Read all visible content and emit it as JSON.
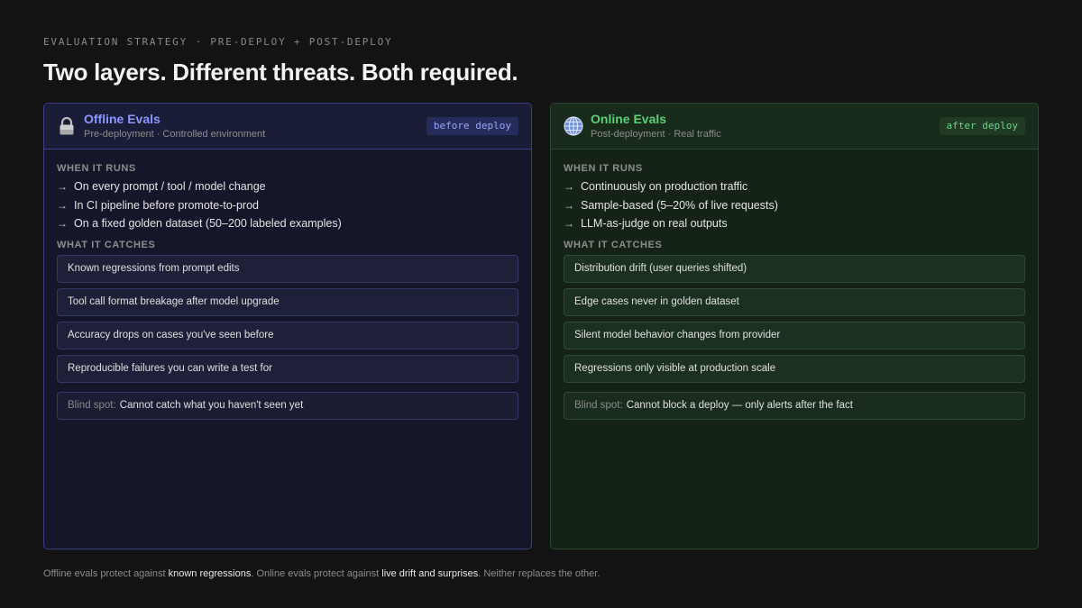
{
  "eyebrow": "EVALUATION STRATEGY · PRE-DEPLOY + POST-DEPLOY",
  "title": "Two layers. Different threats. Both required.",
  "panels": {
    "offline": {
      "icon": "lock-icon",
      "title": "Offline Evals",
      "subtitle": "Pre-deployment · Controlled environment",
      "tag": "before deploy",
      "runs_label": "WHEN IT RUNS",
      "runs": [
        "On every prompt / tool / model change",
        "In CI pipeline before promote-to-prod",
        "On a fixed golden dataset (50–200 labeled examples)"
      ],
      "catches_label": "WHAT IT CATCHES",
      "catches": [
        "Known regressions from prompt edits",
        "Tool call format breakage after model upgrade",
        "Accuracy drops on cases you've seen before",
        "Reproducible failures you can write a test for"
      ],
      "blind_label": "Blind spot:",
      "blind_text": "Cannot catch what you haven't seen yet",
      "accent": "#8c98ff"
    },
    "online": {
      "icon": "globe-icon",
      "title": "Online Evals",
      "subtitle": "Post-deployment · Real traffic",
      "tag": "after deploy",
      "runs_label": "WHEN IT RUNS",
      "runs": [
        "Continuously on production traffic",
        "Sample-based (5–20% of live requests)",
        "LLM-as-judge on real outputs"
      ],
      "catches_label": "WHAT IT CATCHES",
      "catches": [
        "Distribution drift (user queries shifted)",
        "Edge cases never in golden dataset",
        "Silent model behavior changes from provider",
        "Regressions only visible at production scale"
      ],
      "blind_label": "Blind spot:",
      "blind_text": "Cannot block a deploy — only alerts after the fact",
      "accent": "#5ccf7a"
    }
  },
  "footer": {
    "part1": "Offline evals protect against ",
    "hl1": "known regressions",
    "part2": ". Online evals protect against ",
    "hl2": "live drift and surprises",
    "part3": ". Neither replaces the other."
  },
  "arrow_glyph": "→"
}
